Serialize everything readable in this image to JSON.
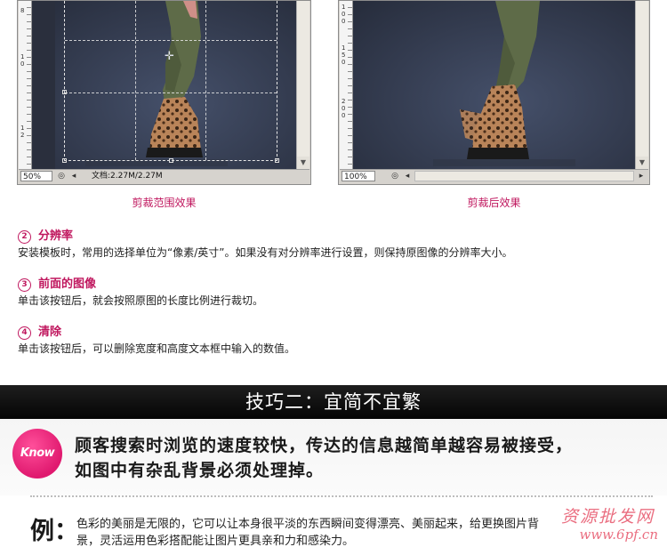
{
  "left_window": {
    "ruler_marks": [
      "8",
      "1",
      "0",
      "1",
      "2"
    ],
    "zoom": "50%",
    "doc_info": "文档:2.27M/2.27M",
    "caption": "剪裁范围效果"
  },
  "right_window": {
    "ruler_marks": [
      "1",
      "0",
      "0",
      "1",
      "5",
      "0",
      "2",
      "0",
      "0"
    ],
    "zoom": "100%",
    "caption": "剪裁后效果"
  },
  "sections": [
    {
      "num": "2",
      "title": "分辨率",
      "desc": "安装模板时，常用的选择单位为“像素/英寸”。如果没有对分辨率进行设置，则保持原图像的分辨率大小。"
    },
    {
      "num": "3",
      "title": "前面的图像",
      "desc": "单击该按钮后，就会按照原图的长度比例进行裁切。"
    },
    {
      "num": "4",
      "title": "清除",
      "desc": "单击该按钮后，可以删除宽度和高度文本框中输入的数值。"
    }
  ],
  "banner": {
    "title": "技巧二：宜简不宜繁"
  },
  "know": {
    "badge": "Know",
    "line1": "顾客搜索时浏览的速度较快，传达的信息越简单越容易被接受，",
    "line2": "如图中有杂乱背景必须处理掉。"
  },
  "example": {
    "label": "例：",
    "line1": "色彩的美丽是无限的，它可以让本身很平淡的东西瞬间变得漂亮、美丽起来，给更换图片背",
    "line2": "景，灵活运用色彩搭配能让图片更具亲和力和感染力。"
  },
  "watermark": {
    "line1": "资源批发网",
    "line2": "www.6pf.cn"
  },
  "colors": {
    "accent": "#c0185f",
    "know_badge": "#e0196f",
    "banner_bg": "#0a0a0a"
  }
}
